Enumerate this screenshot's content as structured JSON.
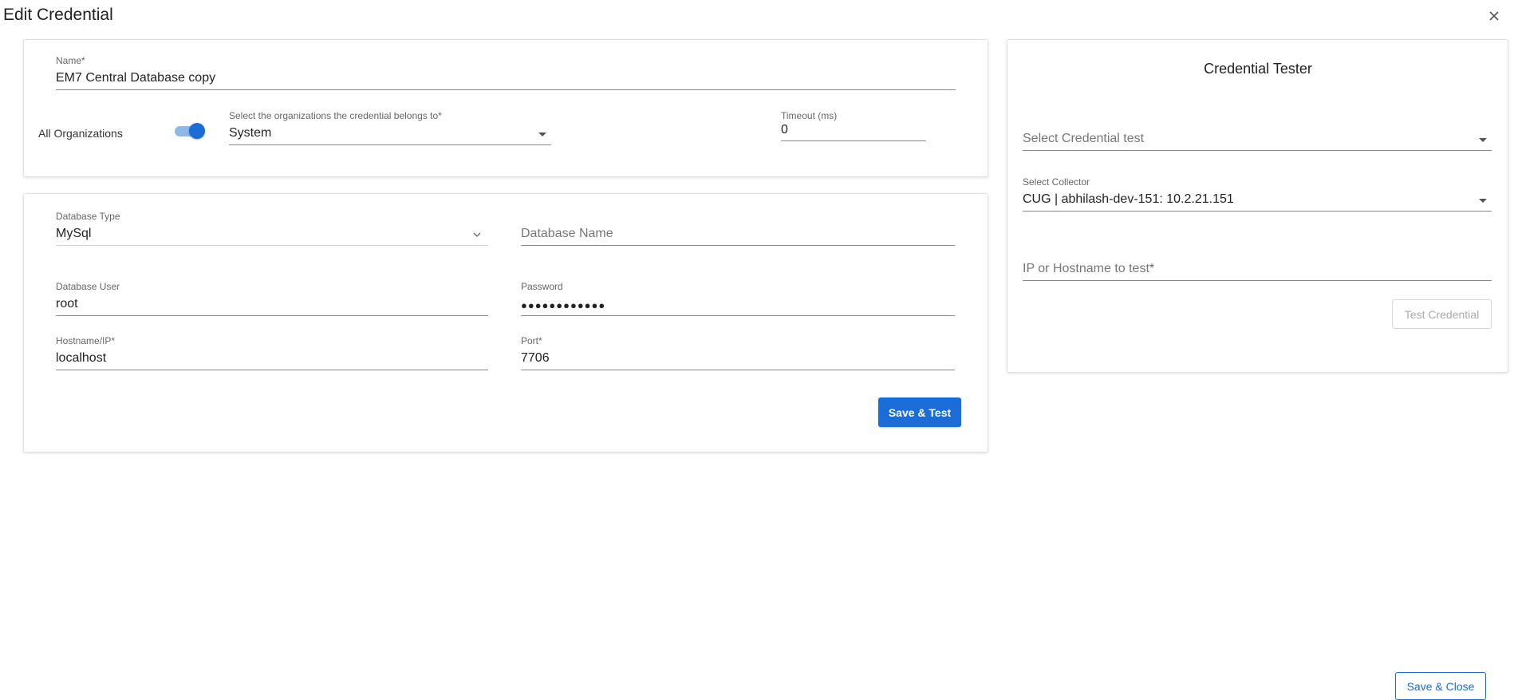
{
  "dialog": {
    "title": "Edit Credential",
    "close_icon": "close-icon"
  },
  "general": {
    "name_label": "Name",
    "name_value": "EM7 Central Database copy",
    "all_orgs_label": "All Organizations",
    "all_orgs_enabled": true,
    "orgs_label": "Select the organizations the credential belongs to",
    "orgs_value": "System",
    "timeout_label": "Timeout (ms)",
    "timeout_value": "0",
    "required_mark": "*"
  },
  "database": {
    "type_label": "Database Type",
    "type_value": "MySql",
    "name_placeholder": "Database Name",
    "user_label": "Database User",
    "user_value": "root",
    "password_label": "Password",
    "password_value": "●●●●●●●●●●●●",
    "hostname_label": "Hostname/IP",
    "hostname_value": "localhost",
    "port_label": "Port",
    "port_value": "7706",
    "save_test_label": "Save & Test"
  },
  "tester": {
    "title": "Credential Tester",
    "test_placeholder": "Select Credential test",
    "collector_label": "Select Collector",
    "collector_value": "CUG | abhilash-dev-151: 10.2.21.151",
    "ip_placeholder": "IP or Hostname to test",
    "test_button_label": "Test Credential"
  },
  "footer": {
    "save_close_label": "Save & Close"
  },
  "colors": {
    "accent": "#1a6dd6",
    "toggle_track": "#8fb8ea"
  }
}
